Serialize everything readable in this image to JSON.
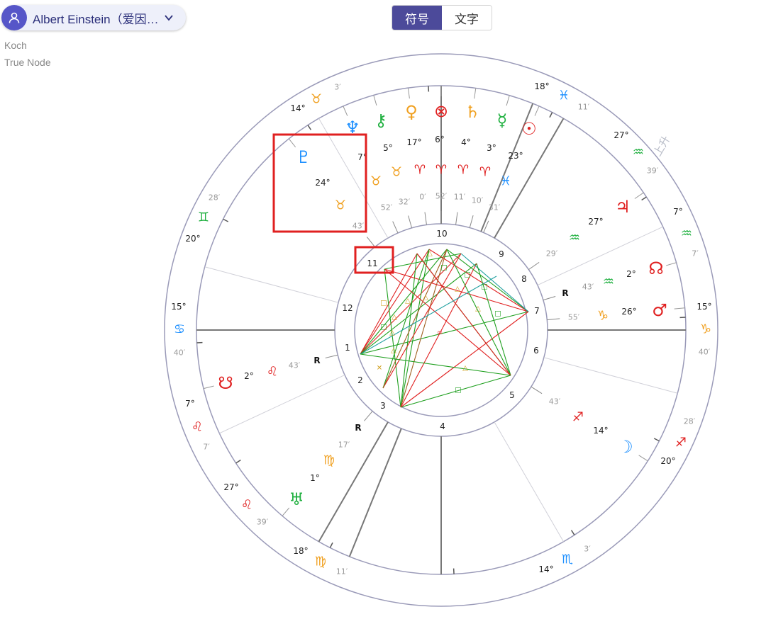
{
  "profile": {
    "name": "Albert Einstein（爱因…",
    "avatar_icon": "user-icon",
    "dropdown_icon": "chevron-down-icon"
  },
  "settings": {
    "house_system": "Koch",
    "node_type": "True Node"
  },
  "view_toggle": {
    "symbol_label": "符号",
    "text_label": "文字",
    "active": "symbol"
  },
  "zodiac": [
    {
      "sign": "taurus",
      "glyph": "♉",
      "deg": "14°",
      "min": "3′",
      "color": "#f0a020"
    },
    {
      "sign": "pisces",
      "glyph": "♓",
      "deg": "18°",
      "min": "11′",
      "color": "#1e90ff"
    },
    {
      "sign": "aquarius",
      "glyph": "♒",
      "deg": "27°",
      "min": "39′",
      "color": "#20b040"
    },
    {
      "sign": "aquarius",
      "glyph": "♒",
      "deg": "7°",
      "min": "7′",
      "color": "#20b040"
    },
    {
      "sign": "capricorn",
      "glyph": "♑",
      "deg": "15°",
      "min": "40′",
      "color": "#f0a020"
    },
    {
      "sign": "sagittarius",
      "glyph": "♐",
      "deg": "20°",
      "min": "28′",
      "color": "#e02020"
    },
    {
      "sign": "scorpio",
      "glyph": "♏",
      "deg": "14°",
      "min": "3′",
      "color": "#1e90ff"
    },
    {
      "sign": "virgo",
      "glyph": "♍",
      "deg": "18°",
      "min": "11′",
      "color": "#f0a020"
    },
    {
      "sign": "leo",
      "glyph": "♌",
      "deg": "27°",
      "min": "39′",
      "color": "#e02020"
    },
    {
      "sign": "leo",
      "glyph": "♌",
      "deg": "7°",
      "min": "7′",
      "color": "#e02020"
    },
    {
      "sign": "cancer",
      "glyph": "♋",
      "deg": "15°",
      "min": "40′",
      "color": "#1e90ff"
    },
    {
      "sign": "gemini",
      "glyph": "♊",
      "deg": "20°",
      "min": "28′",
      "color": "#20b040"
    }
  ],
  "asc_label": "上升",
  "houses": [
    "1",
    "2",
    "3",
    "4",
    "5",
    "6",
    "7",
    "8",
    "9",
    "10",
    "11",
    "12"
  ],
  "planets": [
    {
      "name": "pluto",
      "glyph": "♇",
      "color": "#1e90ff",
      "deg": "24°",
      "min": "43′",
      "sign_glyph": "♉",
      "sign_color": "#f0a020"
    },
    {
      "name": "neptune",
      "glyph": "♆",
      "color": "#1e90ff",
      "deg": "7°",
      "min": "52′",
      "sign_glyph": "♉",
      "sign_color": "#f0a020"
    },
    {
      "name": "chiron",
      "glyph": "⚷",
      "color": "#20b040",
      "deg": "5°",
      "min": "32′",
      "sign_glyph": "♉",
      "sign_color": "#f0a020"
    },
    {
      "name": "venus",
      "glyph": "♀",
      "color": "#f0a020",
      "deg": "17°",
      "min": "0′",
      "sign_glyph": "♈",
      "sign_color": "#e02020"
    },
    {
      "name": "fortune",
      "glyph": "⊗",
      "color": "#e02020",
      "deg": "6°",
      "min": "52′",
      "sign_glyph": "♈",
      "sign_color": "#e02020"
    },
    {
      "name": "saturn",
      "glyph": "♄",
      "color": "#f0a020",
      "deg": "4°",
      "min": "11′",
      "sign_glyph": "♈",
      "sign_color": "#e02020"
    },
    {
      "name": "mercury",
      "glyph": "☿",
      "color": "#20b040",
      "deg": "3°",
      "min": "10′",
      "sign_glyph": "♈",
      "sign_color": "#e02020"
    },
    {
      "name": "sun",
      "glyph": "☉",
      "color": "#e02020",
      "deg": "23°",
      "min": "31′",
      "sign_glyph": "♓",
      "sign_color": "#1e90ff"
    },
    {
      "name": "jupiter",
      "glyph": "♃",
      "color": "#e02020",
      "deg": "27°",
      "min": "29′",
      "sign_glyph": "♒",
      "sign_color": "#20b040"
    },
    {
      "name": "south-node",
      "glyph": "☊",
      "color": "#e02020",
      "deg": "2°",
      "min": "43′",
      "sign_glyph": "♒",
      "sign_color": "#20b040",
      "retro": "R"
    },
    {
      "name": "mars",
      "glyph": "♂",
      "color": "#e02020",
      "deg": "26°",
      "min": "55′",
      "sign_glyph": "♑",
      "sign_color": "#f0a020"
    },
    {
      "name": "moon",
      "glyph": "☽",
      "color": "#1e90ff",
      "deg": "14°",
      "min": "43′",
      "sign_glyph": "♐",
      "sign_color": "#e02020"
    },
    {
      "name": "uranus",
      "glyph": "♅",
      "color": "#20b040",
      "deg": "1°",
      "min": "17′",
      "sign_glyph": "♍",
      "sign_color": "#f0a020",
      "retro": "R"
    },
    {
      "name": "north-node",
      "glyph": "☋",
      "color": "#e02020",
      "deg": "2°",
      "min": "43′",
      "sign_glyph": "♌",
      "sign_color": "#e02020",
      "retro": "R"
    }
  ],
  "aspect_colors": {
    "opposition": "#e02020",
    "trine": "#20a020",
    "square": "#e02020",
    "sextile": "#20a020",
    "other": "#a06020",
    "minor": "#20a0a0"
  },
  "annotation_color": "#e02020"
}
